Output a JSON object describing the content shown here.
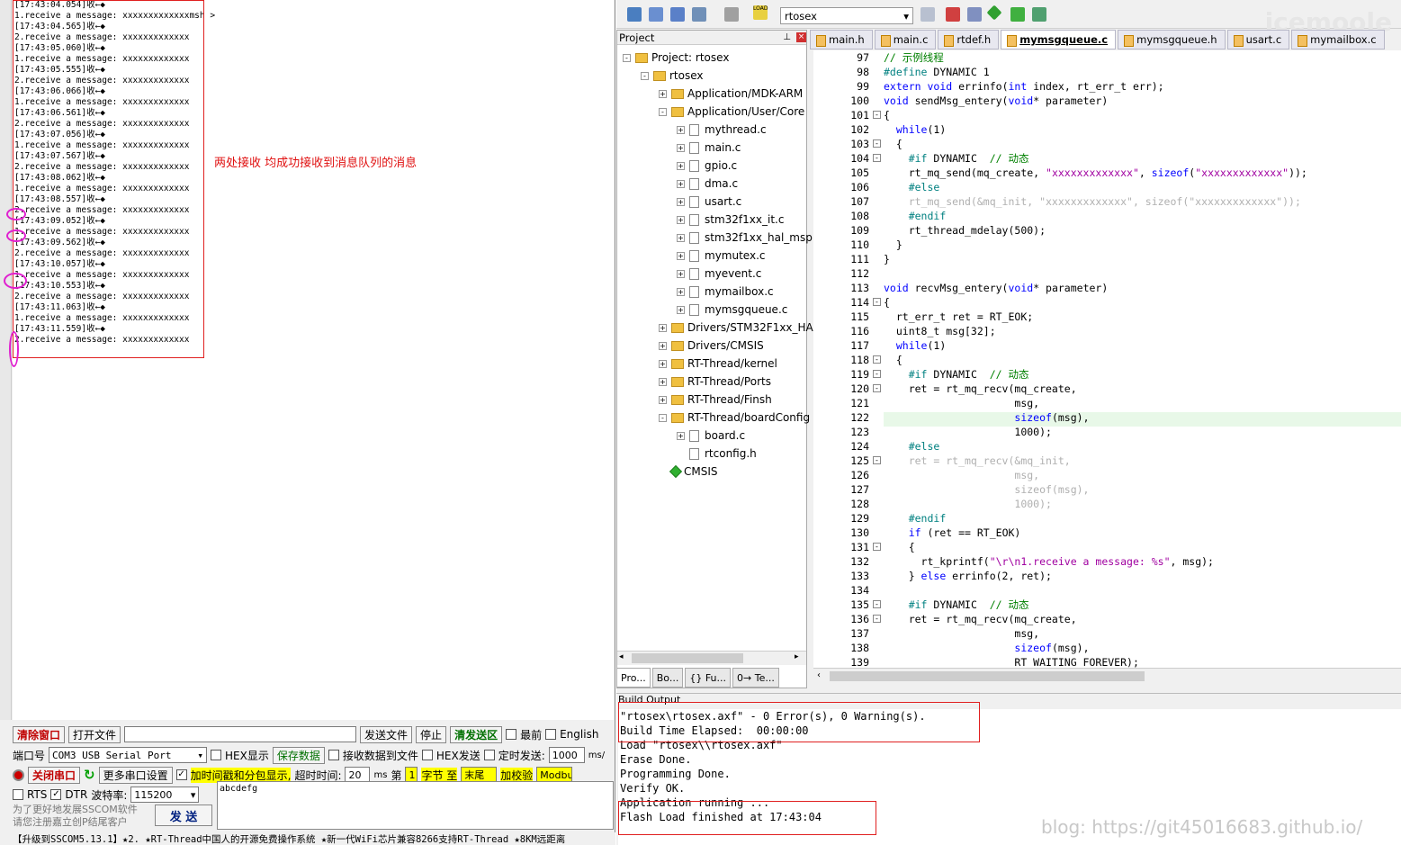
{
  "terminal": {
    "lines": [
      "[17:43:04.054]收←◆",
      "1.receive a message: xxxxxxxxxxxxxmsh >",
      "[17:43:04.565]收←◆",
      "2.receive a message: xxxxxxxxxxxxx",
      "[17:43:05.060]收←◆",
      "1.receive a message: xxxxxxxxxxxxx",
      "[17:43:05.555]收←◆",
      "2.receive a message: xxxxxxxxxxxxx",
      "[17:43:06.066]收←◆",
      "1.receive a message: xxxxxxxxxxxxx",
      "[17:43:06.561]收←◆",
      "2.receive a message: xxxxxxxxxxxxx",
      "[17:43:07.056]收←◆",
      "1.receive a message: xxxxxxxxxxxxx",
      "[17:43:07.567]收←◆",
      "2.receive a message: xxxxxxxxxxxxx",
      "[17:43:08.062]收←◆",
      "1.receive a message: xxxxxxxxxxxxx",
      "[17:43:08.557]收←◆",
      "2.receive a message: xxxxxxxxxxxxx",
      "[17:43:09.052]收←◆",
      "1.receive a message: xxxxxxxxxxxxx",
      "[17:43:09.562]收←◆",
      "2.receive a message: xxxxxxxxxxxxx",
      "[17:43:10.057]收←◆",
      "1.receive a message: xxxxxxxxxxxxx",
      "[17:43:10.553]收←◆",
      "2.receive a message: xxxxxxxxxxxxx",
      "[17:43:11.063]收←◆",
      "1.receive a message: xxxxxxxxxxxxx",
      "[17:43:11.559]收←◆",
      "2.receive a message: xxxxxxxxxxxxx"
    ],
    "annotation": "两处接收 均成功接收到消息队列的消息"
  },
  "serial": {
    "clear_btn": "清除窗口",
    "open_file_btn": "打开文件",
    "send_file_btn": "发送文件",
    "stop_btn": "停止",
    "clear_send_btn": "清发送区",
    "topmost_label": "最前",
    "english_label": "English",
    "port_label": "端口号",
    "port_value": "COM3 USB Serial Port",
    "hex_display_label": "HEX显示",
    "save_data_btn": "保存数据",
    "recv_to_file_label": "接收数据到文件",
    "hex_send_label": "HEX发送",
    "timed_send_label": "定时发送:",
    "timed_value": "1000",
    "timed_unit": "ms/",
    "close_port_btn": "关闭串口",
    "more_settings_btn": "更多串口设置",
    "timestamp_label": "加时间戳和分包显示,",
    "timeout_label": "超时时间:",
    "timeout_value": "20",
    "timeout_unit": "ms",
    "nth_label": "第",
    "nth_value": "1",
    "byte_label": "字节 至",
    "end_value": "末尾",
    "checksum_label": "加校验",
    "checksum_value": "Modbus",
    "rts_label": "RTS",
    "dtr_label": "DTR",
    "baud_label": "波特率:",
    "baud_value": "115200",
    "send_text": "abcdefg",
    "promo_line1": "为了更好地发展SSCOM软件",
    "promo_line2": "请您注册嘉立创P结尾客户",
    "send_btn": "发 送",
    "status_bar": "【升级到SSCOM5.13.1】★2. ★RT-Thread中国人的开源免费操作系统 ★新一代WiFi芯片兼容8266支持RT-Thread ★8KM远距离"
  },
  "ide": {
    "target_name": "rtosex",
    "watermark": "icemoole",
    "project_panel_title": "Project",
    "tree": [
      {
        "label": "Project: rtosex",
        "level": 0,
        "kind": "root",
        "toggle": "-"
      },
      {
        "label": "rtosex",
        "level": 1,
        "kind": "folder",
        "toggle": "-"
      },
      {
        "label": "Application/MDK-ARM",
        "level": 2,
        "kind": "folder",
        "toggle": "+"
      },
      {
        "label": "Application/User/Core",
        "level": 2,
        "kind": "folder",
        "toggle": "-"
      },
      {
        "label": "mythread.c",
        "level": 3,
        "kind": "file",
        "toggle": "+"
      },
      {
        "label": "main.c",
        "level": 3,
        "kind": "file",
        "toggle": "+"
      },
      {
        "label": "gpio.c",
        "level": 3,
        "kind": "file",
        "toggle": "+"
      },
      {
        "label": "dma.c",
        "level": 3,
        "kind": "file",
        "toggle": "+"
      },
      {
        "label": "usart.c",
        "level": 3,
        "kind": "file",
        "toggle": "+"
      },
      {
        "label": "stm32f1xx_it.c",
        "level": 3,
        "kind": "file",
        "toggle": "+"
      },
      {
        "label": "stm32f1xx_hal_msp.",
        "level": 3,
        "kind": "file",
        "toggle": "+"
      },
      {
        "label": "mymutex.c",
        "level": 3,
        "kind": "file",
        "toggle": "+"
      },
      {
        "label": "myevent.c",
        "level": 3,
        "kind": "file",
        "toggle": "+"
      },
      {
        "label": "mymailbox.c",
        "level": 3,
        "kind": "file",
        "toggle": "+"
      },
      {
        "label": "mymsgqueue.c",
        "level": 3,
        "kind": "file",
        "toggle": "+"
      },
      {
        "label": "Drivers/STM32F1xx_HAL",
        "level": 2,
        "kind": "folder",
        "toggle": "+"
      },
      {
        "label": "Drivers/CMSIS",
        "level": 2,
        "kind": "folder",
        "toggle": "+"
      },
      {
        "label": "RT-Thread/kernel",
        "level": 2,
        "kind": "folder",
        "toggle": "+"
      },
      {
        "label": "RT-Thread/Ports",
        "level": 2,
        "kind": "folder",
        "toggle": "+"
      },
      {
        "label": "RT-Thread/Finsh",
        "level": 2,
        "kind": "folder",
        "toggle": "+"
      },
      {
        "label": "RT-Thread/boardConfig",
        "level": 2,
        "kind": "folder",
        "toggle": "-"
      },
      {
        "label": "board.c",
        "level": 3,
        "kind": "file",
        "toggle": "+"
      },
      {
        "label": "rtconfig.h",
        "level": 3,
        "kind": "file",
        "toggle": ""
      },
      {
        "label": "CMSIS",
        "level": 2,
        "kind": "gem",
        "toggle": ""
      }
    ],
    "panel_tabs": [
      "Pro...",
      "Bo...",
      "{} Fu...",
      "0→ Te..."
    ],
    "editor_tabs": [
      {
        "label": "main.h",
        "active": false
      },
      {
        "label": "main.c",
        "active": false
      },
      {
        "label": "rtdef.h",
        "active": false
      },
      {
        "label": "mymsgqueue.c",
        "active": true
      },
      {
        "label": "mymsgqueue.h",
        "active": false
      },
      {
        "label": "usart.c",
        "active": false
      },
      {
        "label": "mymailbox.c",
        "active": false
      }
    ],
    "code_lines": [
      {
        "n": "97",
        "t": "// 示例线程",
        "c": "cm",
        "f": ""
      },
      {
        "n": "98",
        "t": "#define DYNAMIC 1",
        "c": "",
        "f": ""
      },
      {
        "n": "99",
        "t": "extern void errinfo(int index, rt_err_t err);",
        "c": "",
        "f": ""
      },
      {
        "n": "100",
        "t": "void sendMsg_entery(void* parameter)",
        "c": "",
        "f": ""
      },
      {
        "n": "101",
        "t": "{",
        "c": "",
        "f": "-"
      },
      {
        "n": "102",
        "t": "  while(1)",
        "c": "",
        "f": ""
      },
      {
        "n": "103",
        "t": "  {",
        "c": "",
        "f": "-"
      },
      {
        "n": "104",
        "t": "    #if DYNAMIC  // 动态",
        "c": "",
        "f": "-"
      },
      {
        "n": "105",
        "t": "    rt_mq_send(mq_create, \"xxxxxxxxxxxxx\", sizeof(\"xxxxxxxxxxxxx\"));",
        "c": "",
        "f": ""
      },
      {
        "n": "106",
        "t": "    #else",
        "c": "",
        "f": ""
      },
      {
        "n": "107",
        "t": "    rt_mq_send(&mq_init, \"xxxxxxxxxxxxx\", sizeof(\"xxxxxxxxxxxxx\"));",
        "c": "dim",
        "f": ""
      },
      {
        "n": "108",
        "t": "    #endif",
        "c": "",
        "f": ""
      },
      {
        "n": "109",
        "t": "    rt_thread_mdelay(500);",
        "c": "",
        "f": ""
      },
      {
        "n": "110",
        "t": "  }",
        "c": "",
        "f": ""
      },
      {
        "n": "111",
        "t": "}",
        "c": "",
        "f": ""
      },
      {
        "n": "112",
        "t": "",
        "c": "",
        "f": ""
      },
      {
        "n": "113",
        "t": "void recvMsg_entery(void* parameter)",
        "c": "",
        "f": ""
      },
      {
        "n": "114",
        "t": "{",
        "c": "",
        "f": "-"
      },
      {
        "n": "115",
        "t": "  rt_err_t ret = RT_EOK;",
        "c": "",
        "f": ""
      },
      {
        "n": "116",
        "t": "  uint8_t msg[32];",
        "c": "",
        "f": ""
      },
      {
        "n": "117",
        "t": "  while(1)",
        "c": "",
        "f": ""
      },
      {
        "n": "118",
        "t": "  {",
        "c": "",
        "f": "-"
      },
      {
        "n": "119",
        "t": "    #if DYNAMIC  // 动态",
        "c": "",
        "f": "-"
      },
      {
        "n": "120",
        "t": "    ret = rt_mq_recv(mq_create,",
        "c": "",
        "f": "-"
      },
      {
        "n": "121",
        "t": "                     msg,",
        "c": "",
        "f": ""
      },
      {
        "n": "122",
        "t": "                     sizeof(msg),",
        "c": "",
        "f": ""
      },
      {
        "n": "123",
        "t": "                     1000);",
        "c": "",
        "f": ""
      },
      {
        "n": "124",
        "t": "    #else",
        "c": "",
        "f": ""
      },
      {
        "n": "125",
        "t": "    ret = rt_mq_recv(&mq_init,",
        "c": "dim",
        "f": "-"
      },
      {
        "n": "126",
        "t": "                     msg,",
        "c": "dim",
        "f": ""
      },
      {
        "n": "127",
        "t": "                     sizeof(msg),",
        "c": "dim",
        "f": ""
      },
      {
        "n": "128",
        "t": "                     1000);",
        "c": "dim",
        "f": ""
      },
      {
        "n": "129",
        "t": "    #endif",
        "c": "",
        "f": ""
      },
      {
        "n": "130",
        "t": "    if (ret == RT_EOK)",
        "c": "",
        "f": ""
      },
      {
        "n": "131",
        "t": "    {",
        "c": "",
        "f": "-"
      },
      {
        "n": "132",
        "t": "      rt_kprintf(\"\\r\\n1.receive a message: %s\", msg);",
        "c": "",
        "f": ""
      },
      {
        "n": "133",
        "t": "    } else errinfo(2, ret);",
        "c": "",
        "f": ""
      },
      {
        "n": "134",
        "t": "",
        "c": "",
        "f": ""
      },
      {
        "n": "135",
        "t": "    #if DYNAMIC  // 动态",
        "c": "",
        "f": "-"
      },
      {
        "n": "136",
        "t": "    ret = rt_mq_recv(mq_create,",
        "c": "",
        "f": "-"
      },
      {
        "n": "137",
        "t": "                     msg,",
        "c": "",
        "f": ""
      },
      {
        "n": "138",
        "t": "                     sizeof(msg),",
        "c": "",
        "f": ""
      },
      {
        "n": "139",
        "t": "                     RT_WAITING_FOREVER);",
        "c": "",
        "f": ""
      }
    ],
    "build_output_title": "Build Output",
    "build_output": [
      "\"rtosex\\rtosex.axf\" - 0 Error(s), 0 Warning(s).",
      "Build Time Elapsed:  00:00:00",
      "Load \"rtosex\\\\rtosex.axf\"",
      "Erase Done.",
      "Programming Done.",
      "Verify OK.",
      "Application running ...",
      "Flash Load finished at 17:43:04"
    ],
    "blog": "blog: https://git45016683.github.io/"
  }
}
